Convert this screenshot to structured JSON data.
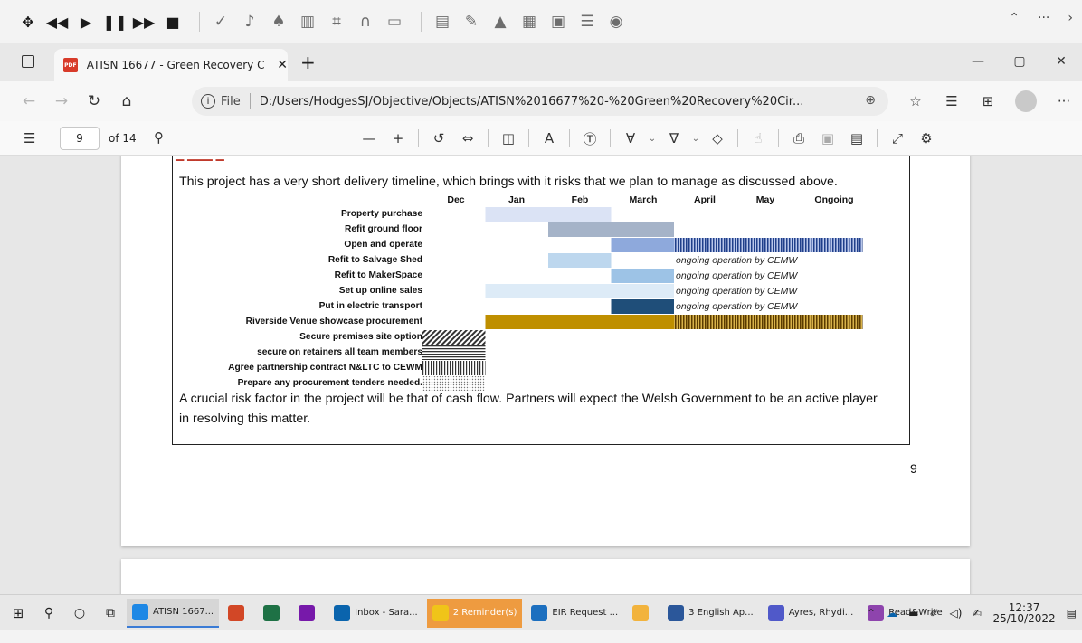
{
  "tab": {
    "title": "ATISN 16677 - Green Recovery C",
    "close_glyph": "✕",
    "new_glyph": "+"
  },
  "address": {
    "scheme_label": "File",
    "url": "D:/Users/HodgesSJ/Objective/Objects/ATISN%2016677%20-%20Green%20Recovery%20Cir..."
  },
  "pdf_toolbar": {
    "page_number": "9",
    "page_of": "of 14"
  },
  "document": {
    "intro": "This project has a very short delivery timeline, which brings with it risks that we plan to manage as discussed above.",
    "conclusion_line1": "A crucial risk factor in the project will be that of cash flow. Partners will expect the Welsh Government to be an active player",
    "conclusion_line2": "in resolving this matter.",
    "page_number": "9"
  },
  "gantt": {
    "columns": [
      "Dec",
      "Jan",
      "Feb",
      "March",
      "April",
      "May",
      "Ongoing"
    ],
    "tasks": [
      {
        "label": "Property purchase",
        "bars": [
          {
            "start": 1,
            "end": 3,
            "fill": "#dbe3f5"
          }
        ]
      },
      {
        "label": "Refit ground floor",
        "bars": [
          {
            "start": 2,
            "end": 4,
            "fill": "#a5b3c8"
          }
        ]
      },
      {
        "label": "Open  and operate",
        "bars": [
          {
            "start": 3,
            "end": 4,
            "fill": "#8ea9dc"
          },
          {
            "start": 4,
            "end": 7,
            "fill": "stripes-blue"
          }
        ]
      },
      {
        "label": "Refit to Salvage Shed",
        "bars": [
          {
            "start": 2,
            "end": 3,
            "fill": "#bdd7ee"
          }
        ],
        "note": "ongoing operation by CEMW"
      },
      {
        "label": "Refit to MakerSpace",
        "bars": [
          {
            "start": 3,
            "end": 4,
            "fill": "#9dc3e6"
          }
        ],
        "note": "ongoing operation by CEMW"
      },
      {
        "label": "Set up online sales",
        "bars": [
          {
            "start": 1,
            "end": 4,
            "fill": "#ddebf7"
          }
        ],
        "note": "ongoing operation by CEMW"
      },
      {
        "label": "Put in electric transport",
        "bars": [
          {
            "start": 3,
            "end": 4,
            "fill": "#1f4e79"
          }
        ],
        "note": "ongoing operation by CEMW"
      },
      {
        "label": "Riverside Venue  showcase procurement",
        "bars": [
          {
            "start": 1,
            "end": 4,
            "fill": "#bf8f00"
          },
          {
            "start": 4,
            "end": 7,
            "fill": "stripes-gold"
          }
        ]
      },
      {
        "label": "Secure premises site option",
        "bars": [
          {
            "start": 0,
            "end": 1,
            "fill": "diag"
          }
        ]
      },
      {
        "label": "secure on retainers all team members",
        "bars": [
          {
            "start": 0,
            "end": 1,
            "fill": "hlines"
          }
        ]
      },
      {
        "label": "Agree partnership contract N&LTC to CEWM",
        "bars": [
          {
            "start": 0,
            "end": 1,
            "fill": "vlines"
          }
        ]
      },
      {
        "label": "Prepare any procurement tenders needed.",
        "bars": [
          {
            "start": 0,
            "end": 1,
            "fill": "dots"
          }
        ]
      }
    ]
  },
  "taskbar": {
    "apps": [
      {
        "label": "ATISN 1667...",
        "color": "#1e88e5",
        "active": true
      },
      {
        "label": "",
        "color": "#d24726"
      },
      {
        "label": "",
        "color": "#1e7145"
      },
      {
        "label": "",
        "color": "#7719aa"
      },
      {
        "label": "Inbox - Sara...",
        "color": "#0a64ad"
      },
      {
        "label": "2 Reminder(s)",
        "color": "#f0c419",
        "remind": true
      },
      {
        "label": "EIR Request ...",
        "color": "#1c6fbf"
      },
      {
        "label": "",
        "color": "#f2b33d"
      },
      {
        "label": "3 English Ap...",
        "color": "#2b579a"
      },
      {
        "label": "Ayres, Rhydi...",
        "color": "#5059c9"
      },
      {
        "label": "Read&Write",
        "color": "#8e44ad"
      }
    ],
    "time": "12:37",
    "date": "25/10/2022"
  }
}
